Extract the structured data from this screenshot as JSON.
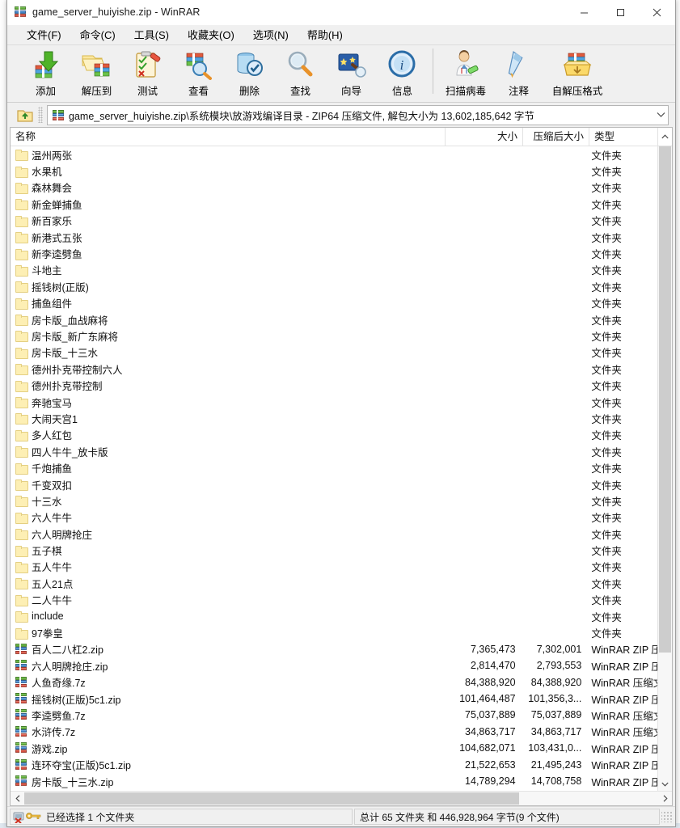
{
  "window": {
    "title": "game_server_huiyishe.zip - WinRAR",
    "app_icon": "winrar-icon",
    "controls": {
      "minimize": "—",
      "maximize": "☐",
      "close": "✕"
    }
  },
  "menu": [
    {
      "label": "文件(F)",
      "accel": "F"
    },
    {
      "label": "命令(C)",
      "accel": "C"
    },
    {
      "label": "工具(S)",
      "accel": "S"
    },
    {
      "label": "收藏夹(O)",
      "accel": "O"
    },
    {
      "label": "选项(N)",
      "accel": "N"
    },
    {
      "label": "帮助(H)",
      "accel": "H"
    }
  ],
  "toolbar": {
    "buttons": [
      {
        "label": "添加",
        "icon": "add-archive-icon"
      },
      {
        "label": "解压到",
        "icon": "extract-to-icon"
      },
      {
        "label": "测试",
        "icon": "test-archive-icon"
      },
      {
        "label": "查看",
        "icon": "view-file-icon"
      },
      {
        "label": "删除",
        "icon": "delete-icon"
      },
      {
        "label": "查找",
        "icon": "find-icon"
      },
      {
        "label": "向导",
        "icon": "wizard-icon"
      },
      {
        "label": "信息",
        "icon": "info-icon"
      }
    ],
    "buttons_group2": [
      {
        "label": "扫描病毒",
        "icon": "virus-scan-icon"
      },
      {
        "label": "注释",
        "icon": "comment-icon"
      },
      {
        "label": "自解压格式",
        "icon": "sfx-icon"
      }
    ]
  },
  "address": {
    "up_icon": "up-folder-icon",
    "archive_icon": "winrar-icon",
    "path": "game_server_huiyishe.zip\\系统模块\\放游戏编译目录 - ZIP64 压缩文件, 解包大小为 13,602,185,642 字节",
    "dropdown_icon": "chevron-down-icon"
  },
  "list": {
    "columns": [
      {
        "key": "name",
        "label": "名称"
      },
      {
        "key": "size",
        "label": "大小"
      },
      {
        "key": "packed",
        "label": "压缩后大小"
      },
      {
        "key": "type",
        "label": "类型"
      }
    ],
    "sort_indicator": "˄",
    "folder_type": "文件夹",
    "rows": [
      {
        "name": "温州两张",
        "size": "",
        "packed": "",
        "type": "文件夹",
        "icon": "folder-icon"
      },
      {
        "name": "水果机",
        "size": "",
        "packed": "",
        "type": "文件夹",
        "icon": "folder-icon"
      },
      {
        "name": "森林舞会",
        "size": "",
        "packed": "",
        "type": "文件夹",
        "icon": "folder-icon"
      },
      {
        "name": "新金蝉捕鱼",
        "size": "",
        "packed": "",
        "type": "文件夹",
        "icon": "folder-icon"
      },
      {
        "name": "新百家乐",
        "size": "",
        "packed": "",
        "type": "文件夹",
        "icon": "folder-icon"
      },
      {
        "name": "新港式五张",
        "size": "",
        "packed": "",
        "type": "文件夹",
        "icon": "folder-icon"
      },
      {
        "name": "新李逵劈鱼",
        "size": "",
        "packed": "",
        "type": "文件夹",
        "icon": "folder-icon"
      },
      {
        "name": "斗地主",
        "size": "",
        "packed": "",
        "type": "文件夹",
        "icon": "folder-icon"
      },
      {
        "name": "摇钱树(正版)",
        "size": "",
        "packed": "",
        "type": "文件夹",
        "icon": "folder-icon"
      },
      {
        "name": "捕鱼组件",
        "size": "",
        "packed": "",
        "type": "文件夹",
        "icon": "folder-icon"
      },
      {
        "name": "房卡版_血战麻将",
        "size": "",
        "packed": "",
        "type": "文件夹",
        "icon": "folder-icon"
      },
      {
        "name": "房卡版_新广东麻将",
        "size": "",
        "packed": "",
        "type": "文件夹",
        "icon": "folder-icon"
      },
      {
        "name": "房卡版_十三水",
        "size": "",
        "packed": "",
        "type": "文件夹",
        "icon": "folder-icon"
      },
      {
        "name": "德州扑克带控制六人",
        "size": "",
        "packed": "",
        "type": "文件夹",
        "icon": "folder-icon"
      },
      {
        "name": "德州扑克带控制",
        "size": "",
        "packed": "",
        "type": "文件夹",
        "icon": "folder-icon"
      },
      {
        "name": "奔驰宝马",
        "size": "",
        "packed": "",
        "type": "文件夹",
        "icon": "folder-icon"
      },
      {
        "name": "大闹天宫1",
        "size": "",
        "packed": "",
        "type": "文件夹",
        "icon": "folder-icon"
      },
      {
        "name": "多人红包",
        "size": "",
        "packed": "",
        "type": "文件夹",
        "icon": "folder-icon"
      },
      {
        "name": "四人牛牛_放卡版",
        "size": "",
        "packed": "",
        "type": "文件夹",
        "icon": "folder-icon"
      },
      {
        "name": "千炮捕鱼",
        "size": "",
        "packed": "",
        "type": "文件夹",
        "icon": "folder-icon"
      },
      {
        "name": "千变双扣",
        "size": "",
        "packed": "",
        "type": "文件夹",
        "icon": "folder-icon"
      },
      {
        "name": "十三水",
        "size": "",
        "packed": "",
        "type": "文件夹",
        "icon": "folder-icon"
      },
      {
        "name": "六人牛牛",
        "size": "",
        "packed": "",
        "type": "文件夹",
        "icon": "folder-icon"
      },
      {
        "name": "六人明牌抢庄",
        "size": "",
        "packed": "",
        "type": "文件夹",
        "icon": "folder-icon"
      },
      {
        "name": "五子棋",
        "size": "",
        "packed": "",
        "type": "文件夹",
        "icon": "folder-icon"
      },
      {
        "name": "五人牛牛",
        "size": "",
        "packed": "",
        "type": "文件夹",
        "icon": "folder-icon"
      },
      {
        "name": "五人21点",
        "size": "",
        "packed": "",
        "type": "文件夹",
        "icon": "folder-icon"
      },
      {
        "name": "二人牛牛",
        "size": "",
        "packed": "",
        "type": "文件夹",
        "icon": "folder-icon"
      },
      {
        "name": "include",
        "size": "",
        "packed": "",
        "type": "文件夹",
        "icon": "folder-icon"
      },
      {
        "name": "97拳皇",
        "size": "",
        "packed": "",
        "type": "文件夹",
        "icon": "folder-icon"
      },
      {
        "name": "百人二八杠2.zip",
        "size": "7,365,473",
        "packed": "7,302,001",
        "type": "WinRAR ZIP 压缩..",
        "icon": "winrar-archive-icon"
      },
      {
        "name": "六人明牌抢庄.zip",
        "size": "2,814,470",
        "packed": "2,793,553",
        "type": "WinRAR ZIP 压缩..",
        "icon": "winrar-archive-icon"
      },
      {
        "name": "人鱼奇缘.7z",
        "size": "84,388,920",
        "packed": "84,388,920",
        "type": "WinRAR 压缩文件..",
        "icon": "winrar-archive-icon"
      },
      {
        "name": "摇钱树(正版)5c1.zip",
        "size": "101,464,487",
        "packed": "101,356,3...",
        "type": "WinRAR ZIP 压缩..",
        "icon": "winrar-archive-icon"
      },
      {
        "name": "李逵劈鱼.7z",
        "size": "75,037,889",
        "packed": "75,037,889",
        "type": "WinRAR 压缩文件..",
        "icon": "winrar-archive-icon"
      },
      {
        "name": "水浒传.7z",
        "size": "34,863,717",
        "packed": "34,863,717",
        "type": "WinRAR 压缩文件..",
        "icon": "winrar-archive-icon"
      },
      {
        "name": "游戏.zip",
        "size": "104,682,071",
        "packed": "103,431,0...",
        "type": "WinRAR ZIP 压缩..",
        "icon": "winrar-archive-icon"
      },
      {
        "name": "连环夺宝(正版)5c1.zip",
        "size": "21,522,653",
        "packed": "21,495,243",
        "type": "WinRAR ZIP 压缩..",
        "icon": "winrar-archive-icon"
      },
      {
        "name": "房卡版_十三水.zip",
        "size": "14,789,294",
        "packed": "14,708,758",
        "type": "WinRAR ZIP 压缩..",
        "icon": "winrar-archive-icon"
      }
    ]
  },
  "status": {
    "left_text": "已经选择 1 个文件夹",
    "right_text": "总计 65 文件夹 和 446,928,964 字节(9 个文件)",
    "left_icons": [
      "selected-files-icon",
      "key-icon"
    ]
  },
  "colors": {
    "window_bg": "#f0f0f0",
    "list_bg": "#ffffff",
    "border": "#b9b9b9",
    "text": "#101010",
    "scroll_thumb": "#cdcdcd"
  }
}
